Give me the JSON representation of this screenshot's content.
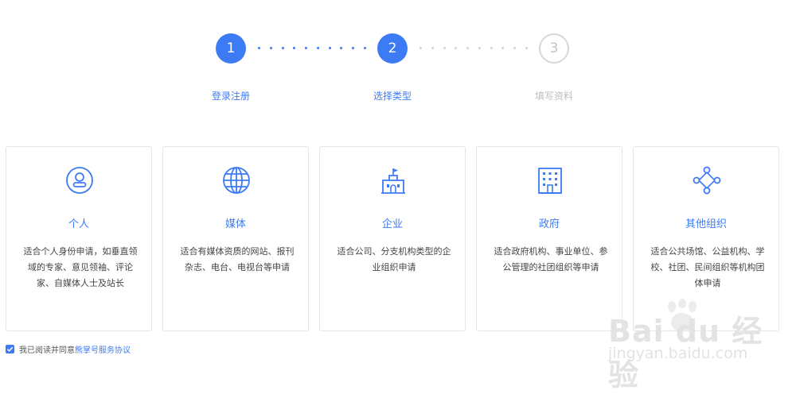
{
  "steps": [
    {
      "number": "1",
      "label": "登录注册",
      "state": "active"
    },
    {
      "number": "2",
      "label": "选择类型",
      "state": "active"
    },
    {
      "number": "3",
      "label": "填写资料",
      "state": "inactive"
    }
  ],
  "colors": {
    "accent": "#3d7bf5",
    "inactive": "#c4c4c4",
    "border": "#e6e6e6"
  },
  "cards": [
    {
      "icon": "user-icon",
      "title": "个人",
      "desc": "适合个人身份申请，如垂直领域的专家、意见领袖、评论家、自媒体人士及站长"
    },
    {
      "icon": "globe-icon",
      "title": "媒体",
      "desc": "适合有媒体资质的网站、报刊杂志、电台、电视台等申请"
    },
    {
      "icon": "building-flag-icon",
      "title": "企业",
      "desc": "适合公司、分支机构类型的企业组织申请"
    },
    {
      "icon": "office-building-icon",
      "title": "政府",
      "desc": "适合政府机构、事业单位、参公管理的社团组织等申请"
    },
    {
      "icon": "network-nodes-icon",
      "title": "其他组织",
      "desc": "适合公共场馆、公益机构、学校、社团、民间组织等机构团体申请"
    }
  ],
  "agreement": {
    "text": "我已阅读并同意",
    "link": "熊掌号服务协议",
    "checked": true
  },
  "watermark": {
    "main": "Bai du 经验",
    "sub": "jingyan.baidu.com"
  }
}
